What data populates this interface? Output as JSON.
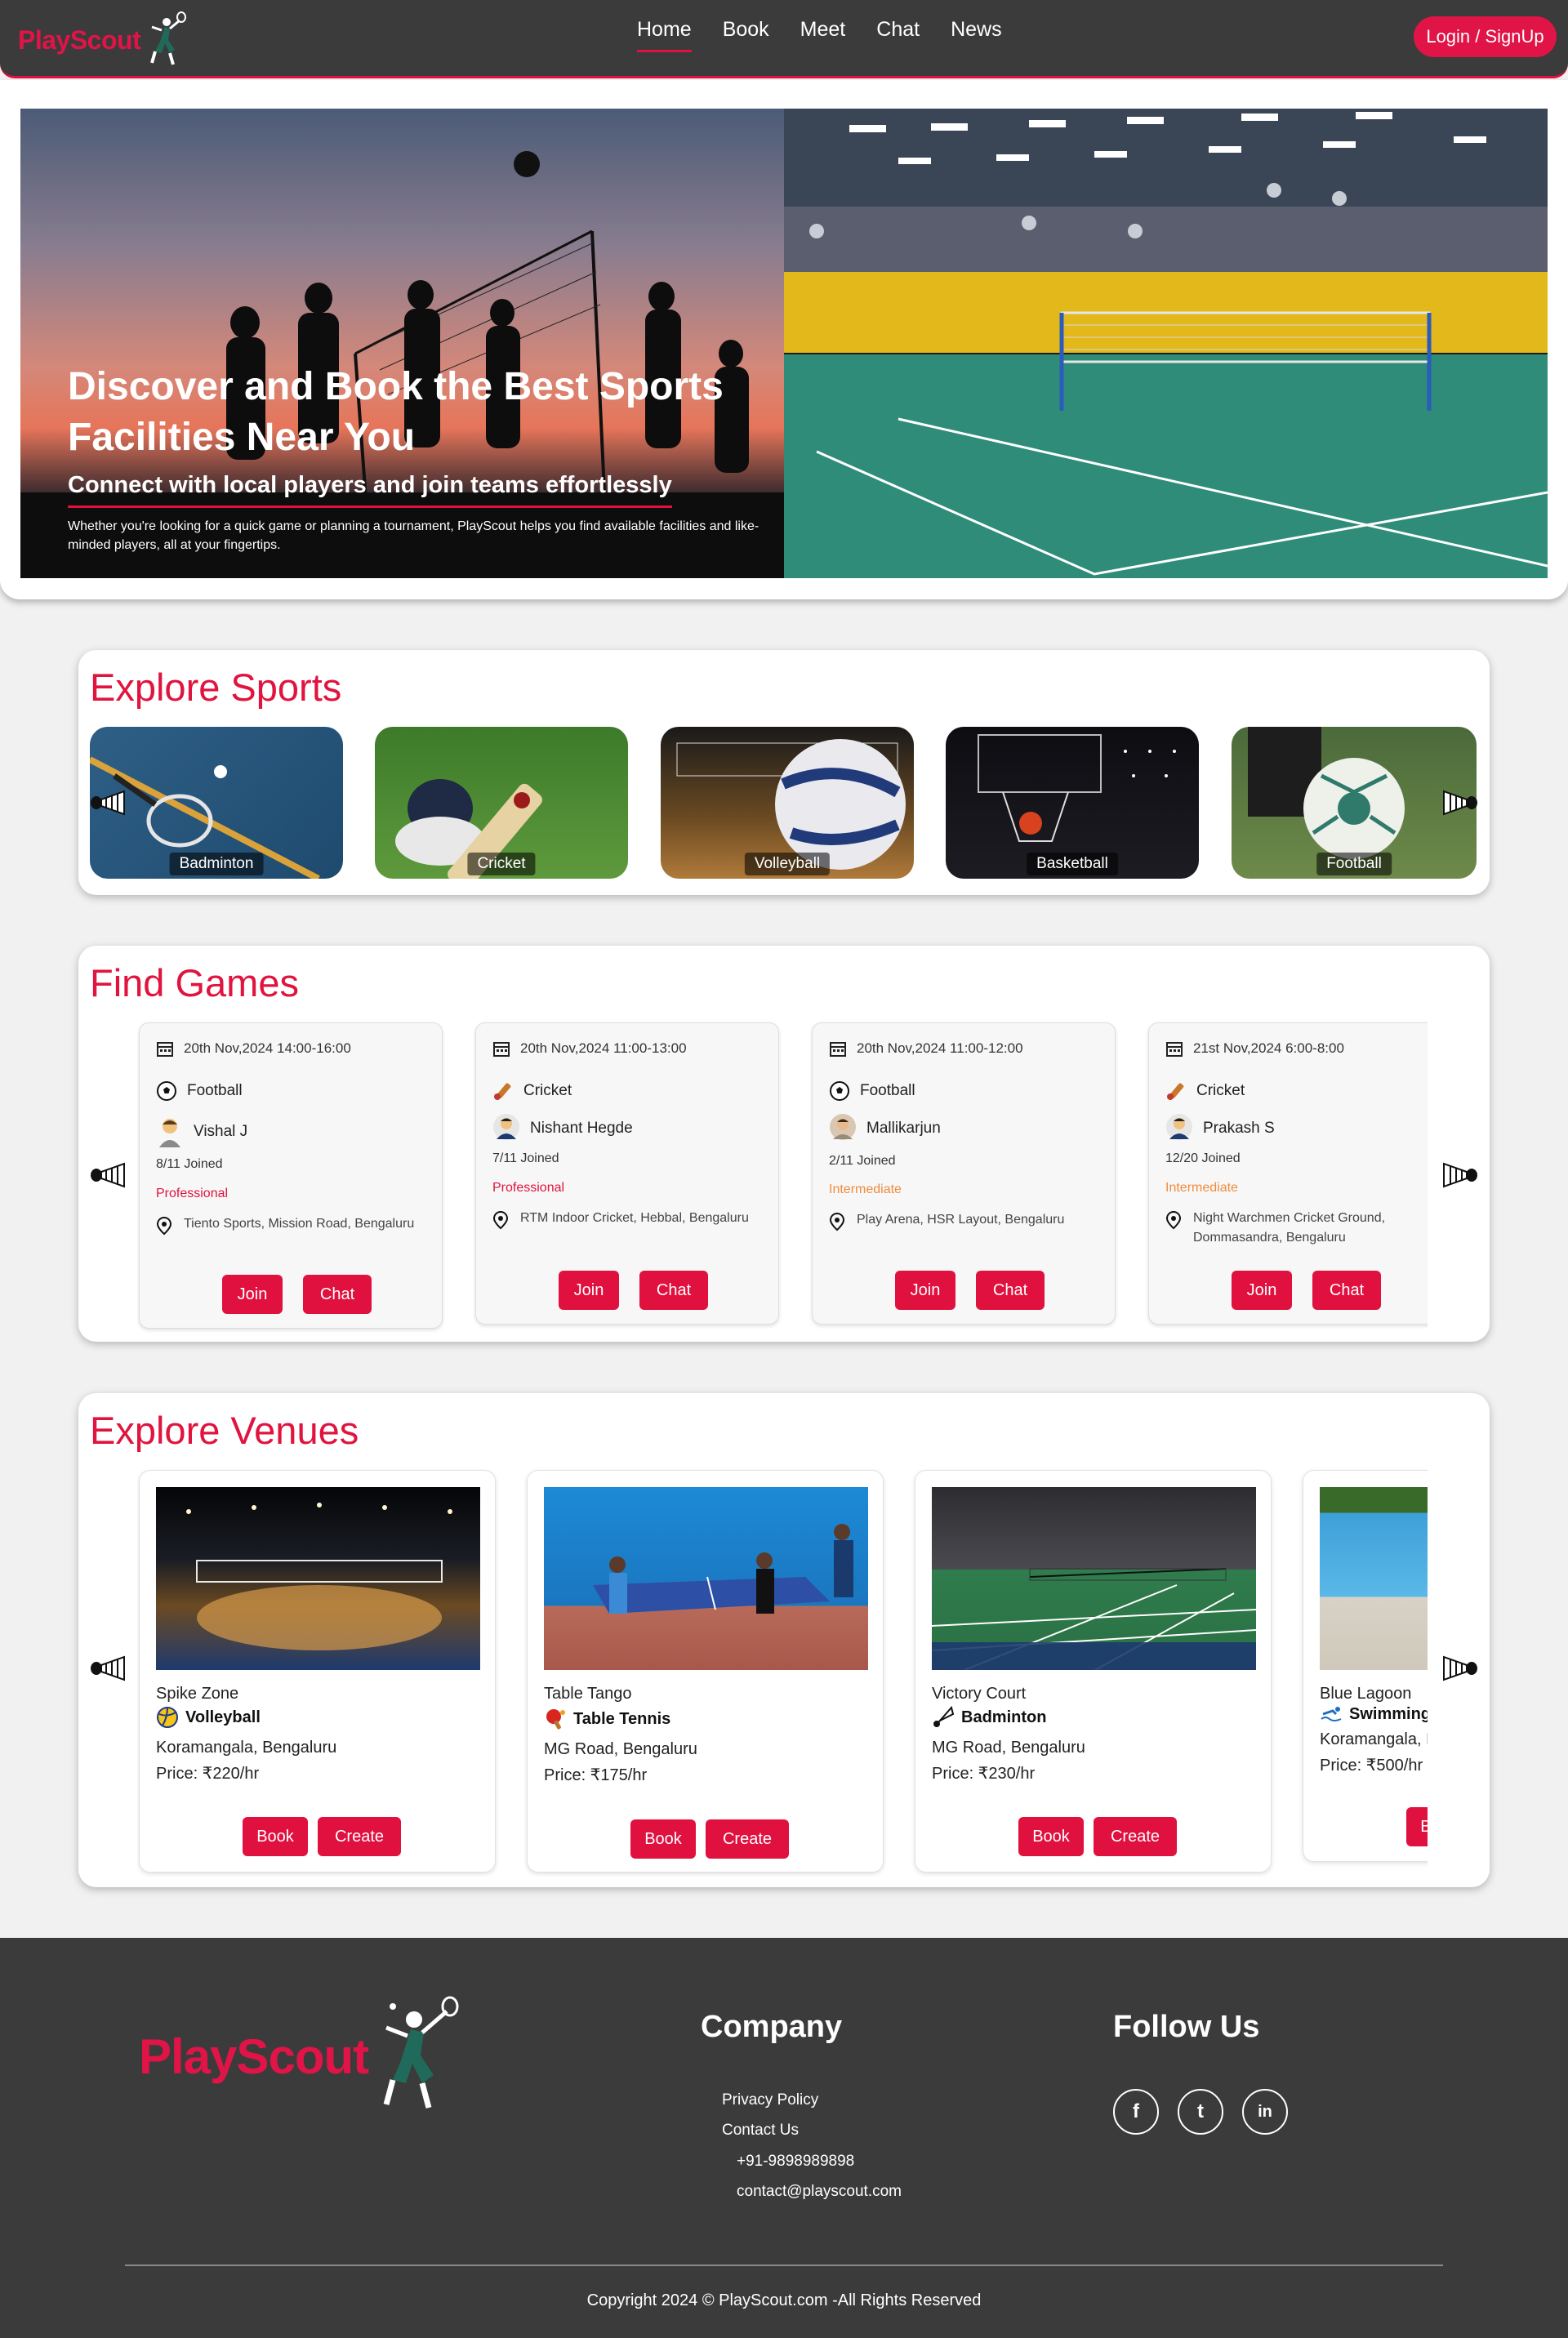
{
  "nav": {
    "brand": "PlayScout",
    "links": [
      "Home",
      "Book",
      "Meet",
      "Chat",
      "News"
    ],
    "active": "Home",
    "login_label": "Login / SignUp"
  },
  "hero": {
    "title": "Discover and Book the Best Sports Facilities Near You",
    "subtitle": "Connect with local players and join teams effortlessly",
    "description": "Whether you're looking for a quick game or planning a tournament, PlayScout helps you find available facilities and like-minded players, all at your fingertips."
  },
  "sports": {
    "title": "Explore Sports",
    "items": [
      "Badminton",
      "Cricket",
      "Volleyball",
      "Basketball",
      "Football"
    ]
  },
  "games": {
    "title": "Find Games",
    "join_label": "Join",
    "chat_label": "Chat",
    "items": [
      {
        "datetime": "20th Nov,2024 14:00-16:00",
        "sport": "Football",
        "host": "Vishal J",
        "joined": "8/11 Joined",
        "level": "Professional",
        "location": "Tiento Sports, Mission Road, Bengaluru"
      },
      {
        "datetime": "20th Nov,2024 11:00-13:00",
        "sport": "Cricket",
        "host": "Nishant Hegde",
        "joined": "7/11 Joined",
        "level": "Professional",
        "location": "RTM Indoor Cricket, Hebbal, Bengaluru"
      },
      {
        "datetime": "20th Nov,2024 11:00-12:00",
        "sport": "Football",
        "host": "Mallikarjun",
        "joined": "2/11 Joined",
        "level": "Intermediate",
        "location": "Play Arena, HSR Layout, Bengaluru"
      },
      {
        "datetime": "21st Nov,2024 6:00-8:00",
        "sport": "Cricket",
        "host": "Prakash S",
        "joined": "12/20 Joined",
        "level": "Intermediate",
        "location": "Night Warchmen Cricket Ground, Dommasandra, Bengaluru"
      }
    ]
  },
  "venues": {
    "title": "Explore Venues",
    "book_label": "Book",
    "create_label": "Create",
    "items": [
      {
        "name": "Spike Zone",
        "sport": "Volleyball",
        "address": "Koramangala, Bengaluru",
        "price": "Price: ₹220/hr"
      },
      {
        "name": "Table Tango",
        "sport": "Table Tennis",
        "address": "MG Road, Bengaluru",
        "price": "Price: ₹175/hr"
      },
      {
        "name": "Victory Court",
        "sport": "Badminton",
        "address": "MG Road, Bengaluru",
        "price": "Price: ₹230/hr"
      },
      {
        "name": "Blue Lagoon",
        "sport": "Swimming",
        "address": "Koramangala, Bengaluru",
        "price": "Price: ₹500/hr"
      }
    ]
  },
  "footer": {
    "brand": "PlayScout",
    "company_heading": "Company",
    "privacy": "Privacy Policy",
    "contact": "Contact Us",
    "phone": "+91-9898989898",
    "email": "contact@playscout.com",
    "follow_heading": "Follow Us",
    "social": [
      "f",
      "t",
      "in"
    ],
    "copyright": "Copyright 2024 © PlayScout.com -All Rights Reserved"
  },
  "colors": {
    "accent": "#e0103f",
    "dark": "#3b3b3b",
    "intermediate": "#f08c3c"
  }
}
